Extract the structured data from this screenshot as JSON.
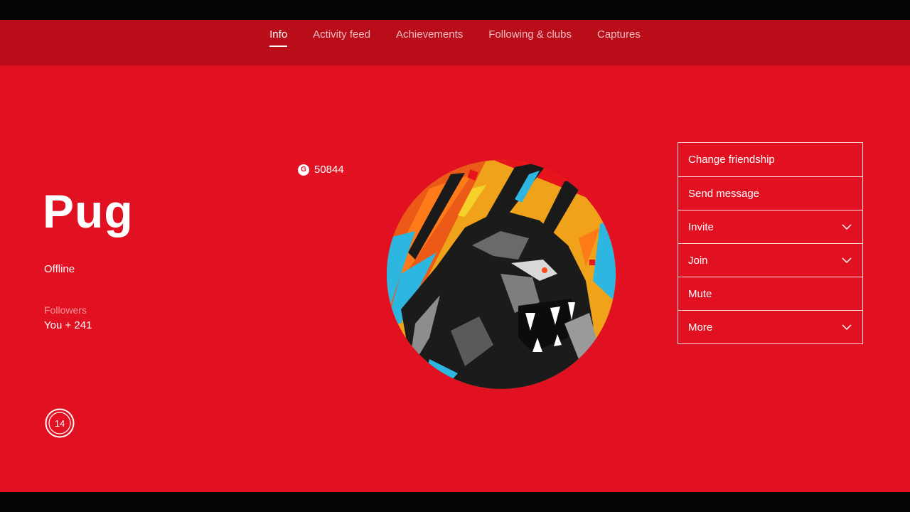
{
  "nav": {
    "tabs": [
      {
        "label": "Info",
        "active": true
      },
      {
        "label": "Activity feed",
        "active": false
      },
      {
        "label": "Achievements",
        "active": false
      },
      {
        "label": "Following & clubs",
        "active": false
      },
      {
        "label": "Captures",
        "active": false
      }
    ]
  },
  "profile": {
    "gamertag": "Pug",
    "status": "Offline",
    "followers_label": "Followers",
    "followers_value": "You + 241",
    "reputation_level": "14",
    "gamerscore_icon": "G",
    "gamerscore": "50844"
  },
  "actions": [
    {
      "label": "Change friendship",
      "has_dropdown": false
    },
    {
      "label": "Send message",
      "has_dropdown": false
    },
    {
      "label": "Invite",
      "has_dropdown": true
    },
    {
      "label": "Join",
      "has_dropdown": true
    },
    {
      "label": "Mute",
      "has_dropdown": false
    },
    {
      "label": "More",
      "has_dropdown": true
    }
  ],
  "icons": {
    "gamerscore": "gamerscore-icon",
    "reputation": "reputation-badge-icon",
    "dropdown": "chevron-down-icon",
    "avatar": "gorilla-gamerpic"
  },
  "colors": {
    "background": "#e21121",
    "nav_background": "#b90d1a",
    "text": "#ffffff"
  }
}
